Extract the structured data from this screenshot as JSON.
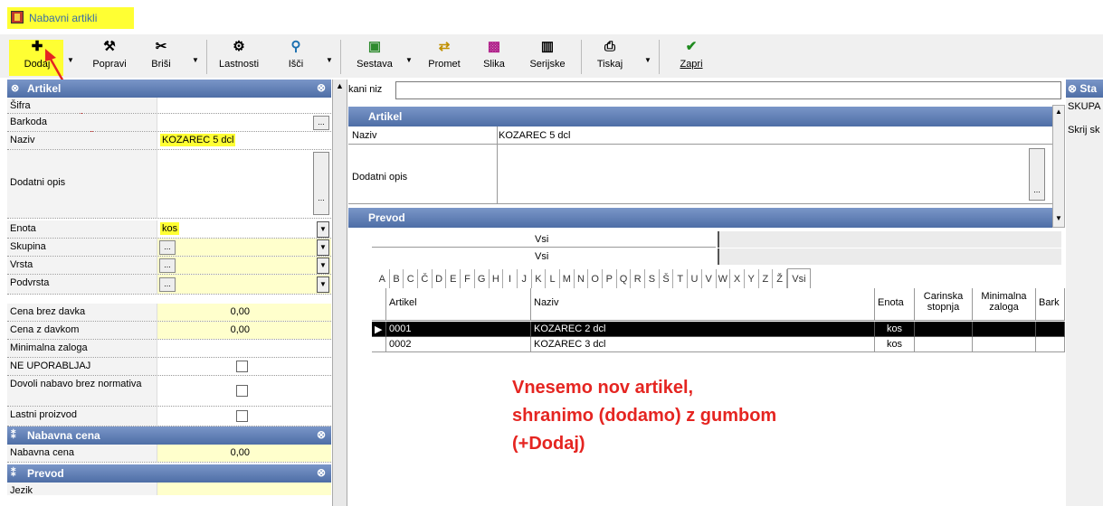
{
  "window": {
    "title": "Nabavni artikli"
  },
  "toolbar": {
    "dodaj": "Dodaj",
    "popravi": "Popravi",
    "brisi": "Briši",
    "lastnosti": "Lastnosti",
    "isci": "Išči",
    "sestava": "Sestava",
    "promet": "Promet",
    "slika": "Slika",
    "serijske": "Serijske",
    "tiskaj": "Tiskaj",
    "zapri": "Zapri"
  },
  "left": {
    "section_artikel": "Artikel",
    "fields": {
      "sifra": "Šifra",
      "barkoda": "Barkoda",
      "naziv": "Naziv",
      "naziv_value": "KOZAREC 5 dcl",
      "dodatni_opis": "Dodatni opis",
      "enota": "Enota",
      "enota_value": "kos",
      "skupina": "Skupina",
      "vrsta": "Vrsta",
      "podvrsta": "Podvrsta",
      "cena_brez": "Cena brez davka",
      "cena_brez_value": "0,00",
      "cena_z": "Cena z davkom",
      "cena_z_value": "0,00",
      "min_zaloga": "Minimalna zaloga",
      "ne_uporabljaj": "NE UPORABLJAJ",
      "dovoli": "Dovoli nabavo brez normativa",
      "lastni": "Lastni proizvod"
    },
    "section_nabavna": "Nabavna cena",
    "nabavna_label": "Nabavna cena",
    "nabavna_value": "0,00",
    "section_prevod": "Prevod",
    "last_row": "Jezik"
  },
  "middle": {
    "search_label": "kani niz",
    "artikel_head": "Artikel",
    "naziv_label": "Naziv",
    "naziv_value": "KOZAREC 5 dcl",
    "dodatni_label": "Dodatni opis",
    "prevod_head": "Prevod",
    "filter1": "Vsi",
    "filter2": "Vsi",
    "alphabet": [
      "A",
      "B",
      "C",
      "Č",
      "D",
      "E",
      "F",
      "G",
      "H",
      "I",
      "J",
      "K",
      "L",
      "M",
      "N",
      "O",
      "P",
      "Q",
      "R",
      "S",
      "Š",
      "T",
      "U",
      "V",
      "W",
      "X",
      "Y",
      "Z",
      "Ž",
      "Vsi"
    ],
    "columns": [
      "Artikel",
      "Naziv",
      "Enota",
      "Carinska stopnja",
      "Minimalna zaloga",
      "Bark"
    ],
    "rows": [
      {
        "artikel": "0001",
        "naziv": "KOZAREC 2 dcl",
        "enota": "kos"
      },
      {
        "artikel": "0002",
        "naziv": "KOZAREC 3 dcl",
        "enota": "kos"
      }
    ]
  },
  "right": {
    "head": "Sta",
    "item1": "SKUPA",
    "item2": "Skrij sk"
  },
  "annotation": [
    "Vnesemo nov artikel,",
    "shranimo (dodamo) z gumbom",
    "(+Dodaj)"
  ],
  "colors": {
    "highlight": "#ffff33",
    "section": "#4e6ea6",
    "annotation": "#e52521"
  }
}
